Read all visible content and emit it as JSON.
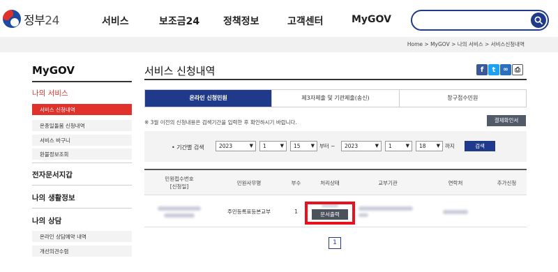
{
  "header": {
    "logo_text": "정부",
    "logo_num": "24",
    "nav": [
      "서비스",
      "보조금24",
      "정책정보",
      "고객센터",
      "MyGOV"
    ],
    "search_placeholder": ""
  },
  "breadcrumb": "Home  >  MyGOV  >  나의 서비스  >  서비스신청내역",
  "sidebar": {
    "title": "MyGOV",
    "sections": [
      {
        "label": "나의 서비스",
        "active": true
      },
      {
        "label": "전자문서지갑"
      },
      {
        "label": "나의 생활정보"
      },
      {
        "label": "나의 상담"
      }
    ],
    "service_items": [
      "서비스 신청내역",
      "온종일돌봄 신청내역",
      "서비스 바구니",
      "환불정보조회"
    ],
    "consult_items": [
      "온라인 상담예약 내역",
      "개선의견수렴"
    ]
  },
  "main": {
    "title": "서비스 신청내역",
    "share": {
      "facebook": "f",
      "twitter": "t",
      "link": "∞",
      "print": "⎙"
    },
    "tabs": [
      "온라인 신청민원",
      "제3자제출 및 기관제출(송신)",
      "창구접수민원"
    ],
    "notice": "※ 3월 이전의 신청내용은 검색기간을 입력한 후 확인하시기 바랍니다.",
    "confirm_button": "결제확인서",
    "filter": {
      "label": "• 기간별 검색",
      "from_year": "2023",
      "from_month": "1",
      "from_day": "15",
      "from_suffix": "부터 ~",
      "to_year": "2023",
      "to_month": "1",
      "to_day": "18",
      "to_suffix": "까지",
      "search_button": "검색"
    },
    "table": {
      "headers": [
        "민원접수번호\n[신청일]",
        "민원사무명",
        "부수",
        "처리상태",
        "교부기관",
        "연락처",
        "추가신청"
      ],
      "row": {
        "service_name": "주민등록표등본교부",
        "copies": "1",
        "print_button": "문서출력",
        "additional": ""
      }
    },
    "pagination": [
      "1"
    ]
  }
}
